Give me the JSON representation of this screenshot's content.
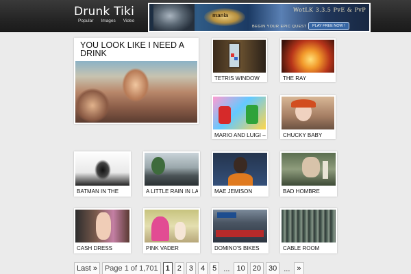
{
  "header": {
    "site_title": "Drunk Tiki",
    "nav": [
      "Popular",
      "Images",
      "Video"
    ]
  },
  "banner": {
    "logo_text": "mania",
    "headline": "WotLK 3.3.5 PvE & PvP",
    "subline": "BEGIN YOUR EPIC QUEST",
    "button": "PLAY FREE NOW !"
  },
  "featured": {
    "title": "YOU LOOK LIKE I NEED A DRINK"
  },
  "posts": [
    {
      "title": "TETRIS WINDOW"
    },
    {
      "title": "THE RAY"
    },
    {
      "title": "MARIO AND LUIGI –"
    },
    {
      "title": "CHUCKY BABY"
    },
    {
      "title": "BATMAN IN THE"
    },
    {
      "title": "A LITTLE RAIN IN LA"
    },
    {
      "title": "MAE JEMISON"
    },
    {
      "title": "BAD HOMBRE"
    },
    {
      "title": "CASH DRESS"
    },
    {
      "title": "PINK VADER"
    },
    {
      "title": "DOMINO'S BIKES"
    },
    {
      "title": "CABLE ROOM"
    }
  ],
  "pagination": {
    "last": "Last »",
    "info": "Page 1 of 1,701",
    "pages": [
      "1",
      "2",
      "3",
      "4",
      "5"
    ],
    "ellipsis": "...",
    "jumps": [
      "10",
      "20",
      "30"
    ],
    "next": "»"
  }
}
